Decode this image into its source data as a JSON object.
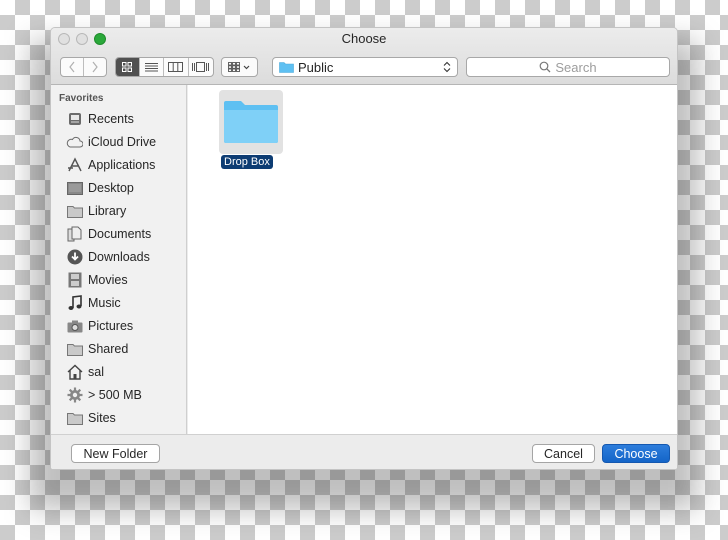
{
  "window": {
    "title": "Choose"
  },
  "toolbar": {
    "back_icon": "chevron-left-icon",
    "forward_icon": "chevron-right-icon",
    "view_modes": [
      {
        "name": "icon-view",
        "icon": "grid-icon",
        "active": true
      },
      {
        "name": "list-view",
        "icon": "list-icon",
        "active": false
      },
      {
        "name": "column-view",
        "icon": "columns-icon",
        "active": false
      },
      {
        "name": "cover-flow-view",
        "icon": "cover-flow-icon",
        "active": false
      }
    ],
    "arrange_icon": "arrange-grid-icon",
    "location": {
      "label": "Public",
      "icon": "folder-icon"
    },
    "search": {
      "placeholder": "Search",
      "icon": "search-icon"
    }
  },
  "sidebar": {
    "heading": "Favorites",
    "items": [
      {
        "label": "Recents",
        "icon": "recents-icon"
      },
      {
        "label": "iCloud Drive",
        "icon": "cloud-icon"
      },
      {
        "label": "Applications",
        "icon": "applications-icon"
      },
      {
        "label": "Desktop",
        "icon": "desktop-icon"
      },
      {
        "label": "Library",
        "icon": "folder-icon"
      },
      {
        "label": "Documents",
        "icon": "documents-icon"
      },
      {
        "label": "Downloads",
        "icon": "downloads-icon"
      },
      {
        "label": "Movies",
        "icon": "movies-icon"
      },
      {
        "label": "Music",
        "icon": "music-icon"
      },
      {
        "label": "Pictures",
        "icon": "camera-icon"
      },
      {
        "label": "Shared",
        "icon": "folder-icon"
      },
      {
        "label": "sal",
        "icon": "home-icon"
      },
      {
        "label": "> 500 MB",
        "icon": "gear-icon"
      },
      {
        "label": "Sites",
        "icon": "folder-icon"
      }
    ]
  },
  "content": {
    "files": [
      {
        "name": "Drop Box",
        "type": "folder",
        "selected": true
      }
    ]
  },
  "footer": {
    "new_folder_label": "New Folder",
    "cancel_label": "Cancel",
    "choose_label": "Choose"
  },
  "colors": {
    "accent": "#1465c8",
    "selection": "#0d3c73",
    "folder": "#5ec0f2",
    "zoom_button": "#2aa83a"
  }
}
